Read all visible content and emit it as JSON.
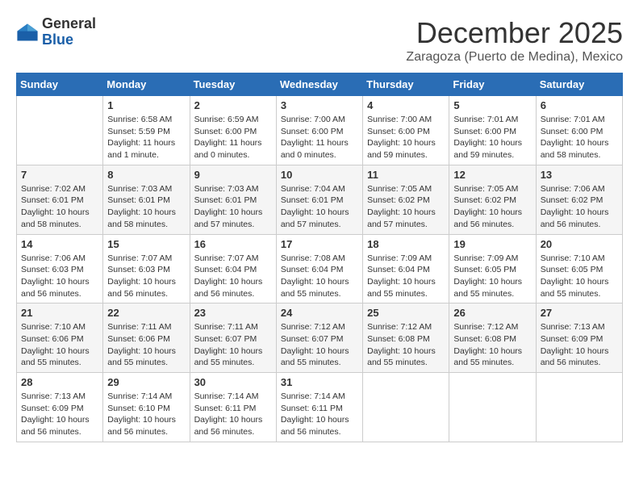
{
  "header": {
    "logo_general": "General",
    "logo_blue": "Blue",
    "month_title": "December 2025",
    "location": "Zaragoza (Puerto de Medina), Mexico"
  },
  "weekdays": [
    "Sunday",
    "Monday",
    "Tuesday",
    "Wednesday",
    "Thursday",
    "Friday",
    "Saturday"
  ],
  "weeks": [
    [
      {
        "day": "",
        "info": ""
      },
      {
        "day": "1",
        "info": "Sunrise: 6:58 AM\nSunset: 5:59 PM\nDaylight: 11 hours\nand 1 minute."
      },
      {
        "day": "2",
        "info": "Sunrise: 6:59 AM\nSunset: 6:00 PM\nDaylight: 11 hours\nand 0 minutes."
      },
      {
        "day": "3",
        "info": "Sunrise: 7:00 AM\nSunset: 6:00 PM\nDaylight: 11 hours\nand 0 minutes."
      },
      {
        "day": "4",
        "info": "Sunrise: 7:00 AM\nSunset: 6:00 PM\nDaylight: 10 hours\nand 59 minutes."
      },
      {
        "day": "5",
        "info": "Sunrise: 7:01 AM\nSunset: 6:00 PM\nDaylight: 10 hours\nand 59 minutes."
      },
      {
        "day": "6",
        "info": "Sunrise: 7:01 AM\nSunset: 6:00 PM\nDaylight: 10 hours\nand 58 minutes."
      }
    ],
    [
      {
        "day": "7",
        "info": "Sunrise: 7:02 AM\nSunset: 6:01 PM\nDaylight: 10 hours\nand 58 minutes."
      },
      {
        "day": "8",
        "info": "Sunrise: 7:03 AM\nSunset: 6:01 PM\nDaylight: 10 hours\nand 58 minutes."
      },
      {
        "day": "9",
        "info": "Sunrise: 7:03 AM\nSunset: 6:01 PM\nDaylight: 10 hours\nand 57 minutes."
      },
      {
        "day": "10",
        "info": "Sunrise: 7:04 AM\nSunset: 6:01 PM\nDaylight: 10 hours\nand 57 minutes."
      },
      {
        "day": "11",
        "info": "Sunrise: 7:05 AM\nSunset: 6:02 PM\nDaylight: 10 hours\nand 57 minutes."
      },
      {
        "day": "12",
        "info": "Sunrise: 7:05 AM\nSunset: 6:02 PM\nDaylight: 10 hours\nand 56 minutes."
      },
      {
        "day": "13",
        "info": "Sunrise: 7:06 AM\nSunset: 6:02 PM\nDaylight: 10 hours\nand 56 minutes."
      }
    ],
    [
      {
        "day": "14",
        "info": "Sunrise: 7:06 AM\nSunset: 6:03 PM\nDaylight: 10 hours\nand 56 minutes."
      },
      {
        "day": "15",
        "info": "Sunrise: 7:07 AM\nSunset: 6:03 PM\nDaylight: 10 hours\nand 56 minutes."
      },
      {
        "day": "16",
        "info": "Sunrise: 7:07 AM\nSunset: 6:04 PM\nDaylight: 10 hours\nand 56 minutes."
      },
      {
        "day": "17",
        "info": "Sunrise: 7:08 AM\nSunset: 6:04 PM\nDaylight: 10 hours\nand 55 minutes."
      },
      {
        "day": "18",
        "info": "Sunrise: 7:09 AM\nSunset: 6:04 PM\nDaylight: 10 hours\nand 55 minutes."
      },
      {
        "day": "19",
        "info": "Sunrise: 7:09 AM\nSunset: 6:05 PM\nDaylight: 10 hours\nand 55 minutes."
      },
      {
        "day": "20",
        "info": "Sunrise: 7:10 AM\nSunset: 6:05 PM\nDaylight: 10 hours\nand 55 minutes."
      }
    ],
    [
      {
        "day": "21",
        "info": "Sunrise: 7:10 AM\nSunset: 6:06 PM\nDaylight: 10 hours\nand 55 minutes."
      },
      {
        "day": "22",
        "info": "Sunrise: 7:11 AM\nSunset: 6:06 PM\nDaylight: 10 hours\nand 55 minutes."
      },
      {
        "day": "23",
        "info": "Sunrise: 7:11 AM\nSunset: 6:07 PM\nDaylight: 10 hours\nand 55 minutes."
      },
      {
        "day": "24",
        "info": "Sunrise: 7:12 AM\nSunset: 6:07 PM\nDaylight: 10 hours\nand 55 minutes."
      },
      {
        "day": "25",
        "info": "Sunrise: 7:12 AM\nSunset: 6:08 PM\nDaylight: 10 hours\nand 55 minutes."
      },
      {
        "day": "26",
        "info": "Sunrise: 7:12 AM\nSunset: 6:08 PM\nDaylight: 10 hours\nand 55 minutes."
      },
      {
        "day": "27",
        "info": "Sunrise: 7:13 AM\nSunset: 6:09 PM\nDaylight: 10 hours\nand 56 minutes."
      }
    ],
    [
      {
        "day": "28",
        "info": "Sunrise: 7:13 AM\nSunset: 6:09 PM\nDaylight: 10 hours\nand 56 minutes."
      },
      {
        "day": "29",
        "info": "Sunrise: 7:14 AM\nSunset: 6:10 PM\nDaylight: 10 hours\nand 56 minutes."
      },
      {
        "day": "30",
        "info": "Sunrise: 7:14 AM\nSunset: 6:11 PM\nDaylight: 10 hours\nand 56 minutes."
      },
      {
        "day": "31",
        "info": "Sunrise: 7:14 AM\nSunset: 6:11 PM\nDaylight: 10 hours\nand 56 minutes."
      },
      {
        "day": "",
        "info": ""
      },
      {
        "day": "",
        "info": ""
      },
      {
        "day": "",
        "info": ""
      }
    ]
  ]
}
